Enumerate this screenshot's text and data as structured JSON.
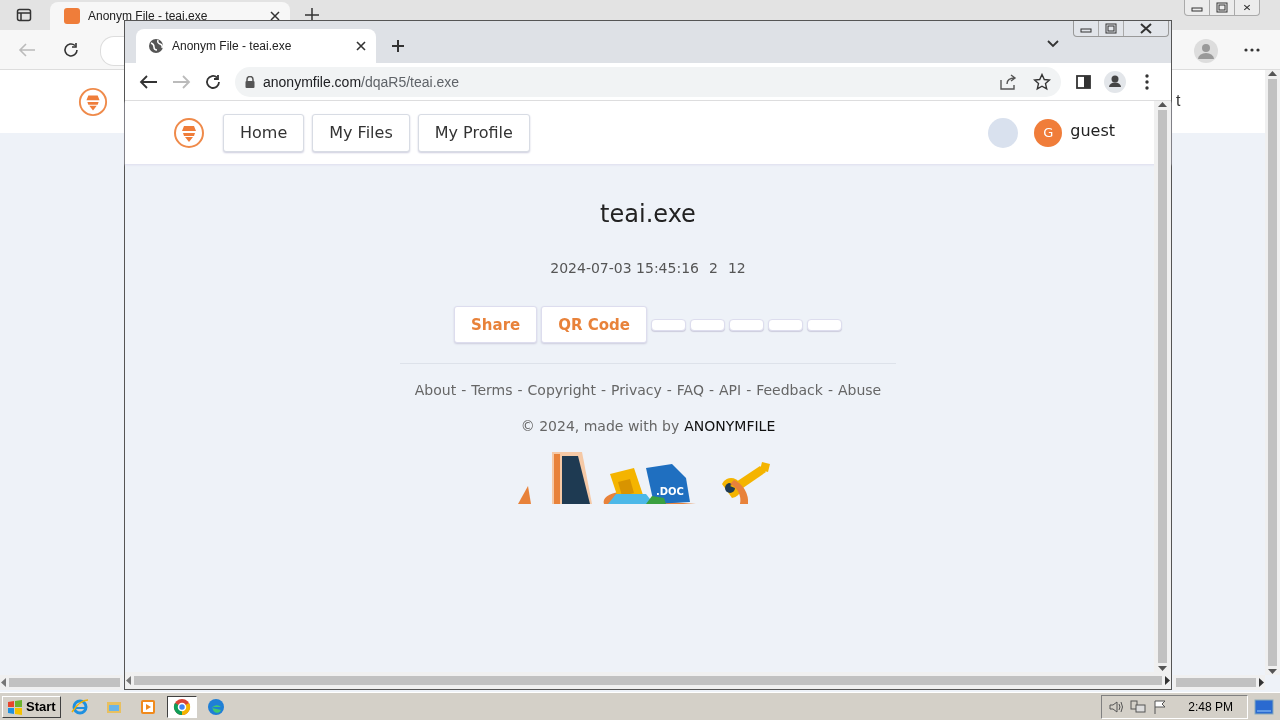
{
  "back_window": {
    "tab": {
      "title": "Anonym File - teai.exe",
      "selected": true
    },
    "page_fragment": "t"
  },
  "window": {
    "tab": {
      "title": "Anonym File - teai.exe",
      "selected": true
    },
    "address": {
      "domain": "anonymfile.com",
      "path": "/dqaR5/teai.exe"
    }
  },
  "nav": [
    {
      "label": "Home"
    },
    {
      "label": "My Files"
    },
    {
      "label": "My Profile"
    }
  ],
  "user": {
    "initial": "G",
    "name": "guest"
  },
  "file": {
    "name": "teai.exe",
    "date": "2024-07-03 15:45:16",
    "stat_1": "2",
    "stat_2": "12"
  },
  "actions": [
    {
      "kind": "labeled",
      "label": "Share"
    },
    {
      "kind": "labeled",
      "label": "QR Code"
    },
    {
      "kind": "blank"
    },
    {
      "kind": "blank"
    },
    {
      "kind": "blank"
    },
    {
      "kind": "blank"
    },
    {
      "kind": "blank"
    }
  ],
  "footer": {
    "separator": "-",
    "links": [
      "About",
      "Terms",
      "Copyright",
      "Privacy",
      "FAQ",
      "API",
      "Feedback",
      "Abuse"
    ],
    "copyright": "© 2024, made with by",
    "brand": "ANONYMFILE"
  },
  "illustration": {
    "doc_label": ".DOC"
  },
  "taskbar": {
    "start": "Start",
    "apps": [
      {
        "kind": "ie",
        "selected": false
      },
      {
        "kind": "folder",
        "selected": false
      },
      {
        "kind": "media",
        "selected": false
      },
      {
        "kind": "chrome",
        "selected": true
      },
      {
        "kind": "edge",
        "selected": false
      }
    ],
    "clock": "2:48 PM"
  }
}
